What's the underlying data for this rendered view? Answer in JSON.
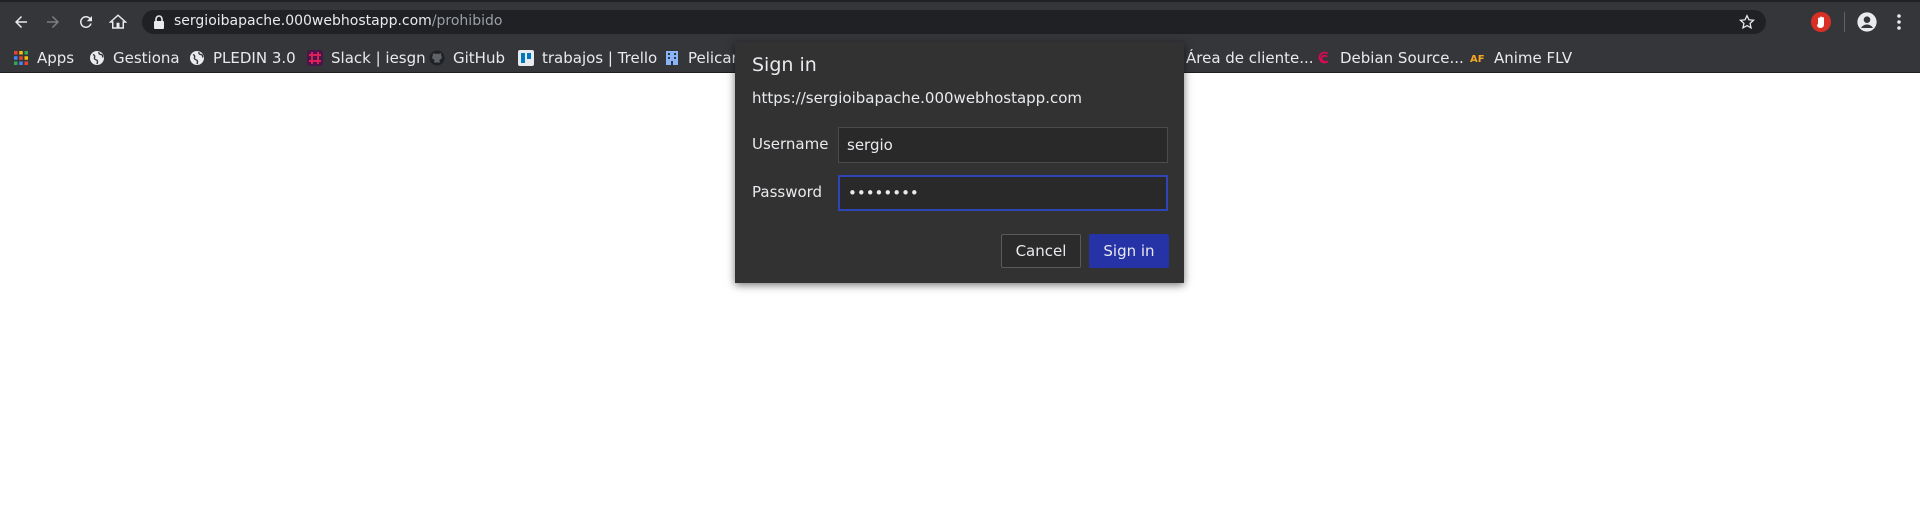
{
  "browser": {
    "url_host": "sergioibapache.000webhostapp.com",
    "url_path": "/prohibido",
    "colors": {
      "toolbar": "#35363a",
      "omnibox": "#202124",
      "accent": "#2633a6"
    }
  },
  "bookmarks": [
    {
      "label": "Apps",
      "icon": "apps-grid-icon"
    },
    {
      "label": "Gestiona",
      "icon": "globe-icon"
    },
    {
      "label": "PLEDIN 3.0",
      "icon": "globe-icon"
    },
    {
      "label": "Slack | iesgn",
      "icon": "slack-icon"
    },
    {
      "label": "GitHub",
      "icon": "github-icon"
    },
    {
      "label": "trabajos | Trello",
      "icon": "trello-icon"
    },
    {
      "label": "Pelican",
      "icon": "building-icon"
    },
    {
      "label": "Área de cliente...",
      "icon": ""
    },
    {
      "label": "Debian Source...",
      "icon": "debian-icon"
    },
    {
      "label": "Anime FLV",
      "icon": "animeflv-icon"
    }
  ],
  "dialog": {
    "title": "Sign in",
    "origin": "https://sergioibapache.000webhostapp.com",
    "username_label": "Username",
    "username_value": "sergio",
    "password_label": "Password",
    "password_value": "••••••••",
    "cancel_label": "Cancel",
    "signin_label": "Sign in"
  }
}
